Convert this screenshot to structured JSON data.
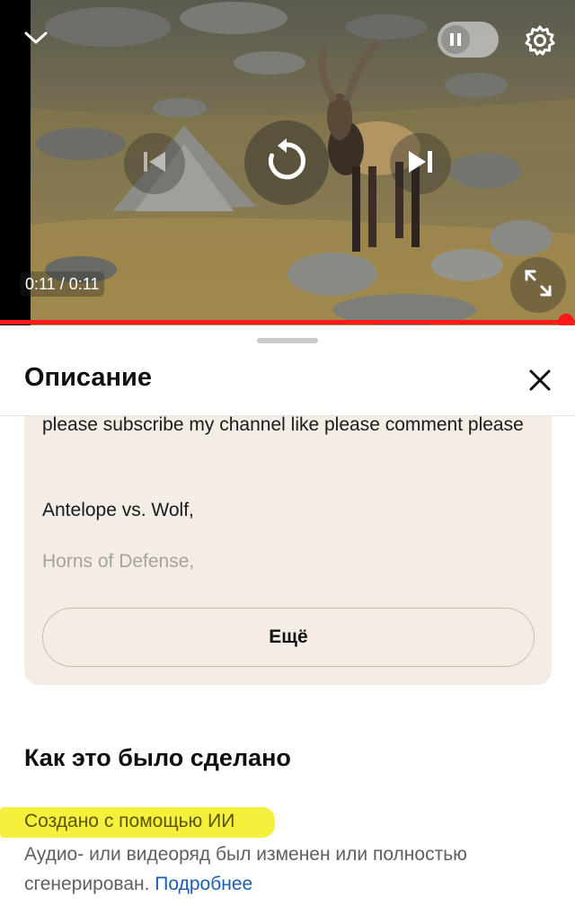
{
  "player": {
    "time_display": "0:11 / 0:11",
    "progress_fraction": 1.0,
    "icons": {
      "collapse": "chevron-down-icon",
      "autoplay": "pause-icon",
      "settings": "gear-icon",
      "previous": "skip-previous-icon",
      "replay": "replay-icon",
      "next": "skip-next-icon",
      "fullscreen": "fullscreen-icon"
    },
    "colors": {
      "progress": "#ff1a1a"
    }
  },
  "sheet": {
    "title": "Описание",
    "close_icon": "close-icon",
    "description": {
      "text": "please subscribe my channel like please comment please",
      "line_1": "Antelope vs. Wolf,",
      "line_2": "Horns of Defense,"
    },
    "more_button": "Ещё"
  },
  "made_section": {
    "title": "Как это было сделано",
    "ai_label": "Создано с помощью ИИ",
    "ai_description": "Аудио- или видеоряд был изменен или полностью сгенерирован.",
    "learn_more": "Подробнее",
    "colors": {
      "highlight": "#f4f03c",
      "link": "#1b5fb0"
    }
  }
}
